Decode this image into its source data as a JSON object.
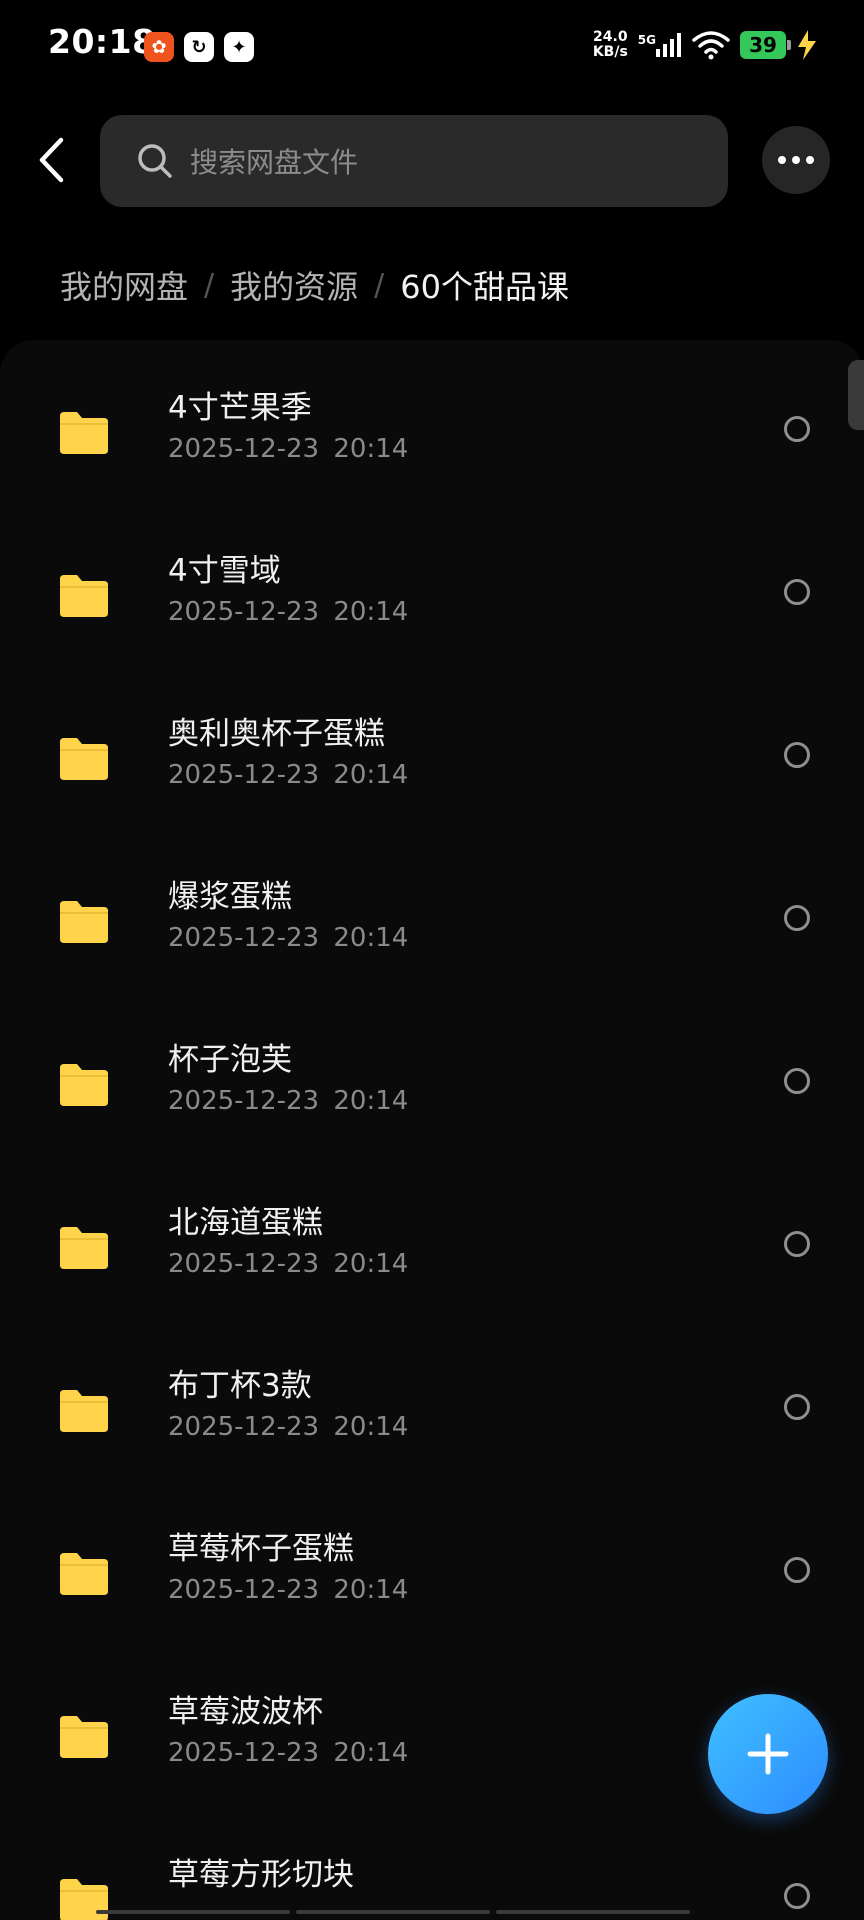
{
  "status_bar": {
    "time": "20:18",
    "net_speed_value": "24.0",
    "net_speed_unit": "KB/s",
    "network": "5G",
    "battery": "39"
  },
  "header": {
    "search_placeholder": "搜索网盘文件"
  },
  "breadcrumb": {
    "items": [
      "我的网盘",
      "我的资源",
      "60个甜品课"
    ],
    "separator": "/"
  },
  "files": [
    {
      "name": "4寸芒果季",
      "date": "2025-12-23",
      "time": "20:14"
    },
    {
      "name": "4寸雪域",
      "date": "2025-12-23",
      "time": "20:14"
    },
    {
      "name": "奥利奥杯子蛋糕",
      "date": "2025-12-23",
      "time": "20:14"
    },
    {
      "name": "爆浆蛋糕",
      "date": "2025-12-23",
      "time": "20:14"
    },
    {
      "name": "杯子泡芙",
      "date": "2025-12-23",
      "time": "20:14"
    },
    {
      "name": "北海道蛋糕",
      "date": "2025-12-23",
      "time": "20:14"
    },
    {
      "name": "布丁杯3款",
      "date": "2025-12-23",
      "time": "20:14"
    },
    {
      "name": "草莓杯子蛋糕",
      "date": "2025-12-23",
      "time": "20:14"
    },
    {
      "name": "草莓波波杯",
      "date": "2025-12-23",
      "time": "20:14"
    },
    {
      "name": "草莓方形切块",
      "date": "",
      "time": ""
    }
  ],
  "colors": {
    "folder": "#ffd34a",
    "fab": "#2d8cff"
  }
}
